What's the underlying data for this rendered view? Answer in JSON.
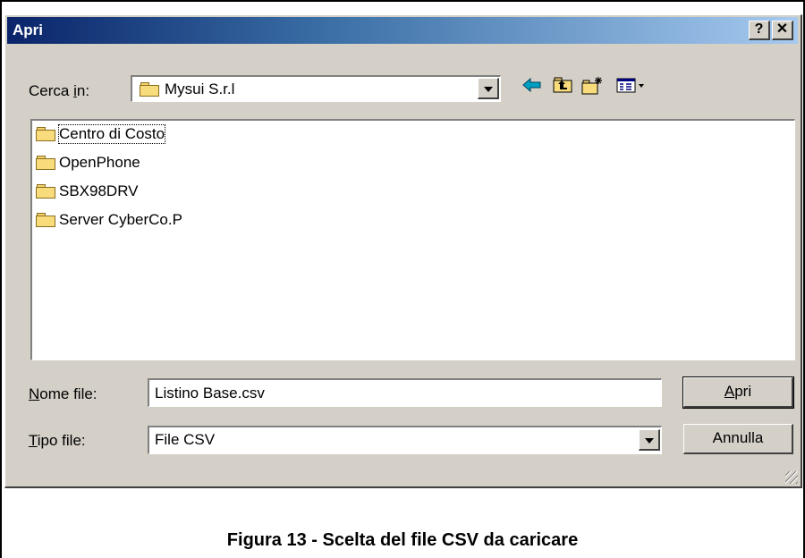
{
  "window": {
    "title": "Apri",
    "help_label": "?",
    "close_label": "✕"
  },
  "lookin": {
    "label_pre": "Cerca ",
    "label_accel": "i",
    "label_post": "n:",
    "value": "Mysui S.r.l"
  },
  "toolbar": {
    "icons": [
      "back-arrow-icon",
      "up-folder-icon",
      "new-folder-icon",
      "view-menu-icon"
    ]
  },
  "files": [
    {
      "name": "Centro di Costo",
      "selected": true
    },
    {
      "name": "OpenPhone",
      "selected": false
    },
    {
      "name": "SBX98DRV",
      "selected": false
    },
    {
      "name": "Server CyberCo.P",
      "selected": false
    }
  ],
  "filename": {
    "label_accel": "N",
    "label_rest": "ome file:",
    "value": "Listino Base.csv"
  },
  "filetype": {
    "label_accel": "T",
    "label_rest": "ipo file:",
    "value": "File CSV"
  },
  "buttons": {
    "open_accel": "A",
    "open_rest": "pri",
    "cancel": "Annulla"
  },
  "caption": "Figura 13 - Scelta del file CSV da caricare",
  "colors": {
    "titlebar_start": "#0a246a",
    "titlebar_end": "#a6caf0",
    "dialog_bg": "#d4d0c8",
    "folder": "#f8dc7c"
  }
}
